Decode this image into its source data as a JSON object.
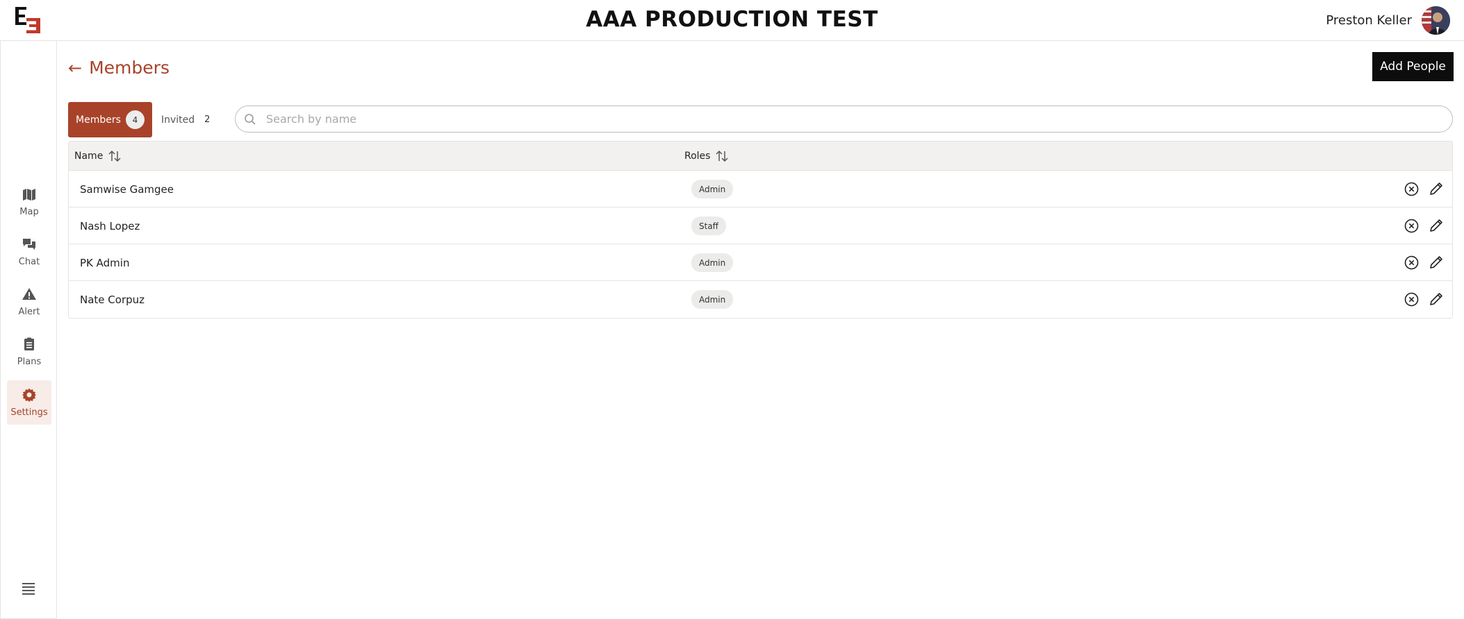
{
  "header": {
    "app_title": "AAA PRODUCTION TEST",
    "user_name": "Preston Keller"
  },
  "sidebar": {
    "items": [
      {
        "label": "Map",
        "icon": "map-icon"
      },
      {
        "label": "Chat",
        "icon": "chat-icon"
      },
      {
        "label": "Alert",
        "icon": "alert-icon"
      },
      {
        "label": "Plans",
        "icon": "plans-icon"
      },
      {
        "label": "Settings",
        "icon": "gear-icon",
        "active": true
      }
    ],
    "menu_icon": "menu-icon"
  },
  "page": {
    "title": "Members",
    "add_button": "Add People"
  },
  "tabs": {
    "members": {
      "label": "Members",
      "count": "4"
    },
    "invited": {
      "label": "Invited",
      "count": "2"
    }
  },
  "search": {
    "placeholder": "Search by name",
    "value": ""
  },
  "table": {
    "columns": [
      "Name",
      "Roles"
    ],
    "rows": [
      {
        "name": "Samwise Gamgee",
        "role": "Admin"
      },
      {
        "name": "Nash Lopez",
        "role": "Staff"
      },
      {
        "name": "PK Admin",
        "role": "Admin"
      },
      {
        "name": "Nate Corpuz",
        "role": "Admin"
      }
    ]
  },
  "colors": {
    "accent": "#a8432a",
    "button_dark": "#0d0d0d"
  }
}
